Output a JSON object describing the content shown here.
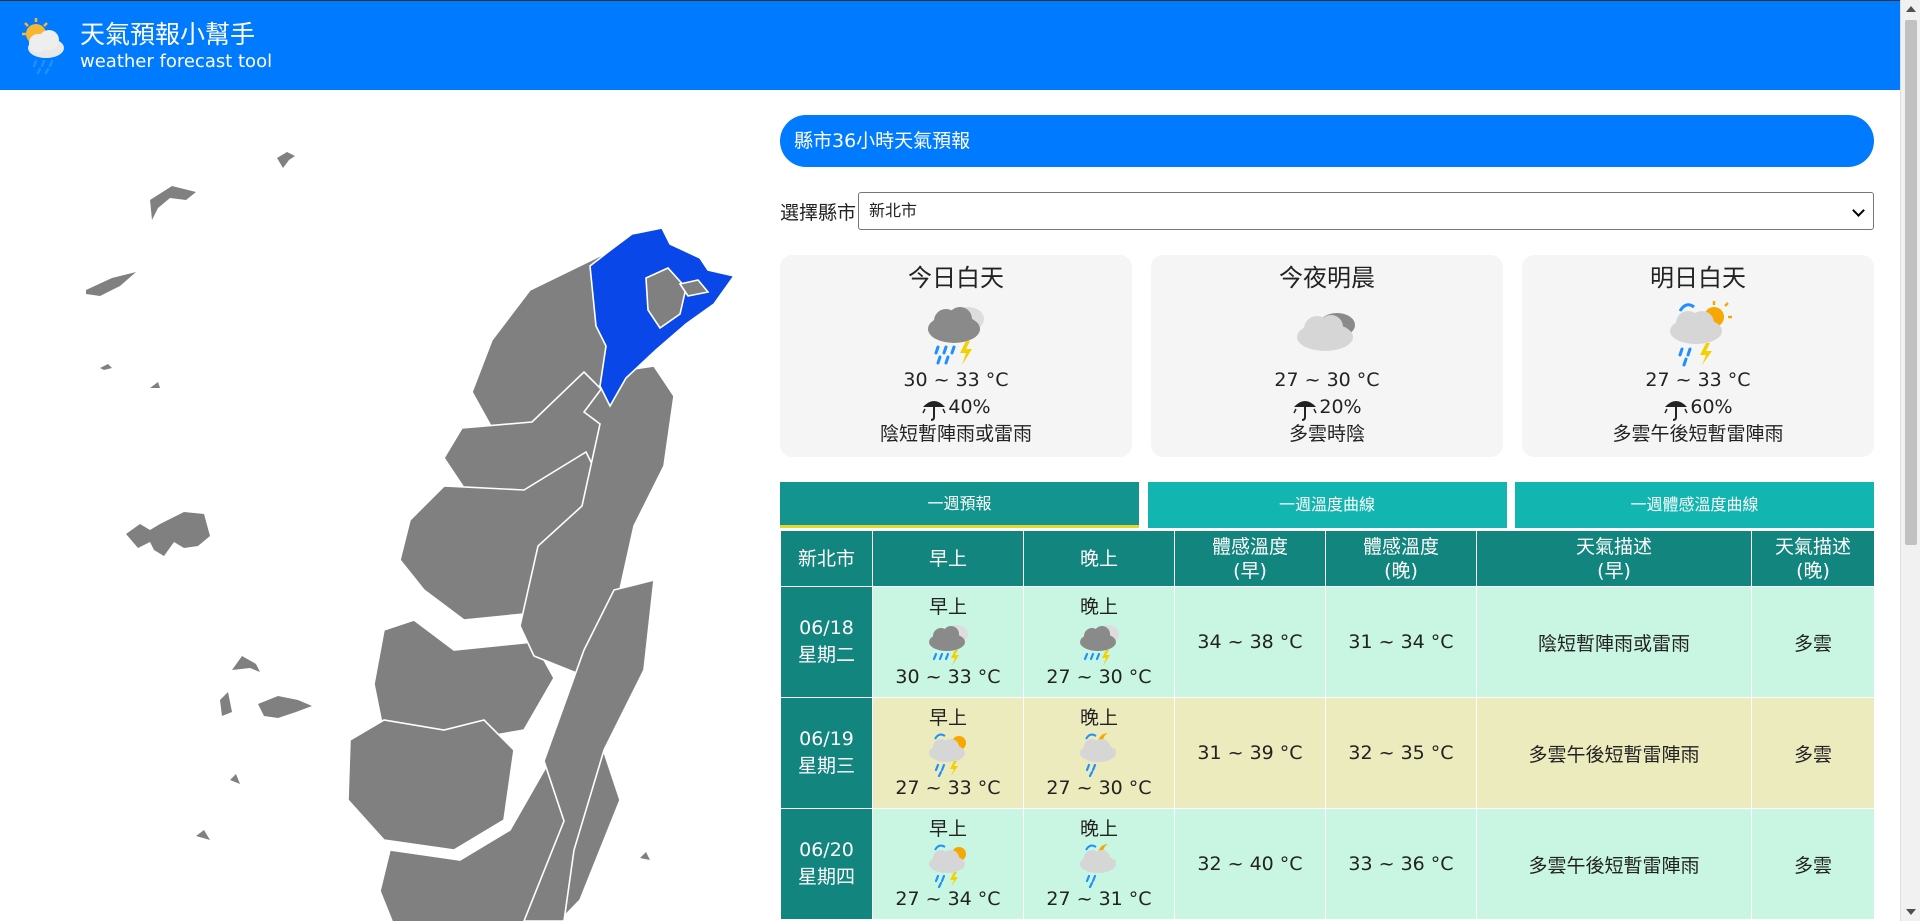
{
  "header": {
    "title": "天氣預報小幫手",
    "subtitle": "weather forecast tool"
  },
  "panel_title": "縣市36小時天氣預報",
  "city_select": {
    "label": "選擇縣市",
    "selected": "新北市"
  },
  "cards": [
    {
      "period": "今日白天",
      "icon": "rain-thunder-icon",
      "temp": "30 ~ 33 °C",
      "rain": "40%",
      "desc": "陰短暫陣雨或雷雨"
    },
    {
      "period": "今夜明晨",
      "icon": "cloudy-icon",
      "temp": "27 ~ 30 °C",
      "rain": "20%",
      "desc": "多雲時陰"
    },
    {
      "period": "明日白天",
      "icon": "sun-rain-thunder-icon",
      "temp": "27 ~ 33 °C",
      "rain": "60%",
      "desc": "多雲午後短暫雷陣雨"
    }
  ],
  "tabs": [
    "一週預報",
    "一週溫度曲線",
    "一週體感溫度曲線"
  ],
  "table": {
    "headers": [
      "新北市",
      "早上",
      "晚上",
      "體感溫度\n(早)",
      "體感溫度\n(晚)",
      "天氣描述\n(早)",
      "天氣描述\n(晚)"
    ],
    "headers_h": {
      "c0": "新北市",
      "c1": "早上",
      "c2": "晚上",
      "c3a": "體感溫度",
      "c3b": "(早)",
      "c4a": "體感溫度",
      "c4b": "(晚)",
      "c5a": "天氣描述",
      "c5b": "(早)",
      "c6a": "天氣描述",
      "c6b": "(晚)"
    },
    "rows": [
      {
        "date": "06/18",
        "weekday": "星期二",
        "am_label": "早上",
        "am_temp": "30 ~ 33 °C",
        "pm_label": "晚上",
        "pm_temp": "27 ~ 30 °C",
        "feel_am": "34 ~ 38 °C",
        "feel_pm": "31 ~ 34 °C",
        "desc_am": "陰短暫陣雨或雷雨",
        "desc_pm": "多雲"
      },
      {
        "date": "06/19",
        "weekday": "星期三",
        "am_label": "早上",
        "am_temp": "27 ~ 33 °C",
        "pm_label": "晚上",
        "pm_temp": "27 ~ 30 °C",
        "feel_am": "31 ~ 39 °C",
        "feel_pm": "32 ~ 35 °C",
        "desc_am": "多雲午後短暫雷陣雨",
        "desc_pm": "多雲"
      },
      {
        "date": "06/20",
        "weekday": "星期四",
        "am_label": "早上",
        "am_temp": "27 ~ 34 °C",
        "pm_label": "晚上",
        "pm_temp": "27 ~ 31 °C",
        "feel_am": "32 ~ 40 °C",
        "feel_pm": "33 ~ 36 °C",
        "desc_am": "多雲午後短暫雷陣雨",
        "desc_pm": "多雲"
      }
    ]
  },
  "colors": {
    "brand": "#007bff",
    "selected_county": "#0a47e8",
    "county": "#808080",
    "table_head": "#13857f",
    "tab": "#12b5b0",
    "row_green": "#c9f6e2",
    "row_yellow": "#ecebbd"
  }
}
